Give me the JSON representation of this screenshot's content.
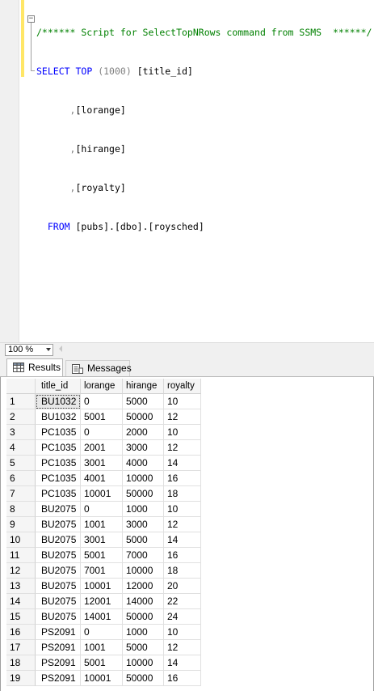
{
  "editor": {
    "comment_line": "/****** Script for SelectTopNRows command from SSMS  ******/",
    "select_kw": "SELECT",
    "top_kw": "TOP",
    "top_value": "(1000)",
    "col1": "[title_id]",
    "col2_prefix": ",",
    "col2": "[lorange]",
    "col3_prefix": ",",
    "col3": "[hirange]",
    "col4_prefix": ",",
    "col4": "[royalty]",
    "from_kw": "FROM",
    "from_target": "[pubs].[dbo].[roysched]",
    "collapse_glyph": "−"
  },
  "zoom": {
    "value": "100 %"
  },
  "tabs": [
    {
      "label": "Results",
      "icon": "grid-icon",
      "active": true
    },
    {
      "label": "Messages",
      "icon": "messages-icon",
      "active": false
    }
  ],
  "grid": {
    "columns": [
      "title_id",
      "lorange",
      "hirange",
      "royalty"
    ],
    "rows": [
      [
        "1",
        "BU1032",
        "0",
        "5000",
        "10"
      ],
      [
        "2",
        "BU1032",
        "5001",
        "50000",
        "12"
      ],
      [
        "3",
        "PC1035",
        "0",
        "2000",
        "10"
      ],
      [
        "4",
        "PC1035",
        "2001",
        "3000",
        "12"
      ],
      [
        "5",
        "PC1035",
        "3001",
        "4000",
        "14"
      ],
      [
        "6",
        "PC1035",
        "4001",
        "10000",
        "16"
      ],
      [
        "7",
        "PC1035",
        "10001",
        "50000",
        "18"
      ],
      [
        "8",
        "BU2075",
        "0",
        "1000",
        "10"
      ],
      [
        "9",
        "BU2075",
        "1001",
        "3000",
        "12"
      ],
      [
        "10",
        "BU2075",
        "3001",
        "5000",
        "14"
      ],
      [
        "11",
        "BU2075",
        "5001",
        "7000",
        "16"
      ],
      [
        "12",
        "BU2075",
        "7001",
        "10000",
        "18"
      ],
      [
        "13",
        "BU2075",
        "10001",
        "12000",
        "20"
      ],
      [
        "14",
        "BU2075",
        "12001",
        "14000",
        "22"
      ],
      [
        "15",
        "BU2075",
        "14001",
        "50000",
        "24"
      ],
      [
        "16",
        "PS2091",
        "0",
        "1000",
        "10"
      ],
      [
        "17",
        "PS2091",
        "1001",
        "5000",
        "12"
      ],
      [
        "18",
        "PS2091",
        "5001",
        "10000",
        "14"
      ],
      [
        "19",
        "PS2091",
        "10001",
        "50000",
        "16"
      ]
    ]
  }
}
